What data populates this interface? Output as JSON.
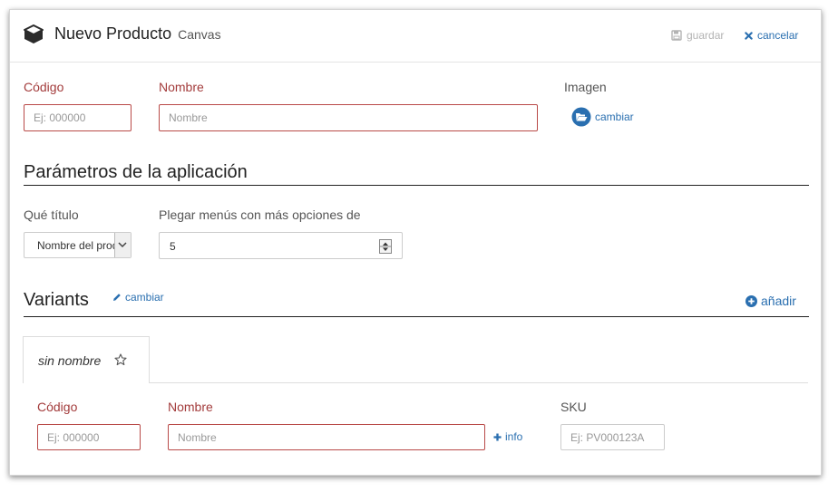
{
  "header": {
    "title": "Nuevo Producto",
    "subtitle": "Canvas",
    "save_label": "guardar",
    "cancel_label": "cancelar"
  },
  "product": {
    "code_label": "Código",
    "code_placeholder": "Ej: 000000",
    "name_label": "Nombre",
    "name_placeholder": "Nombre",
    "image_label": "Imagen",
    "image_change": "cambiar"
  },
  "params": {
    "heading": "Parámetros de la aplicación",
    "title_label": "Qué título",
    "title_selected": "Nombre del producto",
    "menus_label": "Plegar menús con más opciones de",
    "menus_value": "5"
  },
  "variants": {
    "heading": "Variants",
    "change_label": "cambiar",
    "add_label": "añadir",
    "tabs": [
      {
        "label": "sin nombre"
      }
    ],
    "code_label": "Código",
    "code_placeholder": "Ej: 000000",
    "name_label": "Nombre",
    "name_placeholder": "Nombre",
    "info_label": "info",
    "sku_label": "SKU",
    "sku_placeholder": "Ej: PV000123A"
  },
  "colors": {
    "required_label": "#a33c3c",
    "link": "#2a6fb0",
    "error_border": "#b94a48"
  }
}
